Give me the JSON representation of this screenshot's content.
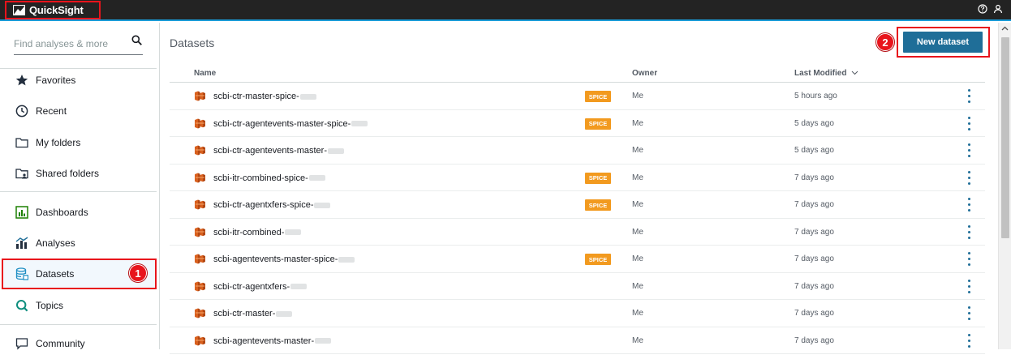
{
  "app": {
    "name": "QuickSight",
    "accent_color": "#1b9bd7",
    "highlight_color": "#e8141c",
    "primary_button_color": "#1f6e98"
  },
  "topbar": {
    "icons": [
      "help-icon",
      "user-icon"
    ]
  },
  "sidebar": {
    "search_placeholder": "Find analyses & more",
    "items": [
      {
        "label": "Favorites",
        "icon": "star-icon"
      },
      {
        "label": "Recent",
        "icon": "clock-icon"
      },
      {
        "label": "My folders",
        "icon": "folder-icon"
      },
      {
        "label": "Shared folders",
        "icon": "shared-folder-icon"
      },
      {
        "label": "Dashboards",
        "icon": "dashboard-icon"
      },
      {
        "label": "Analyses",
        "icon": "analyses-icon"
      },
      {
        "label": "Datasets",
        "icon": "dataset-icon",
        "active": true
      },
      {
        "label": "Topics",
        "icon": "topics-icon"
      },
      {
        "label": "Community",
        "icon": "community-icon"
      }
    ],
    "step_badge": "1"
  },
  "main": {
    "title": "Datasets",
    "new_button_label": "New dataset",
    "step_badge": "2",
    "columns": {
      "name": "Name",
      "owner": "Owner",
      "last_modified": "Last Modified"
    },
    "rows": [
      {
        "name": "scbi-ctr-master-spice-",
        "spice": "SPICE",
        "owner": "Me",
        "modified": "5 hours ago"
      },
      {
        "name": "scbi-ctr-agentevents-master-spice-",
        "spice": "SPICE",
        "owner": "Me",
        "modified": "5 days ago"
      },
      {
        "name": "scbi-ctr-agentevents-master-",
        "spice": "",
        "owner": "Me",
        "modified": "5 days ago"
      },
      {
        "name": "scbi-itr-combined-spice-",
        "spice": "SPICE",
        "owner": "Me",
        "modified": "7 days ago"
      },
      {
        "name": "scbi-ctr-agentxfers-spice-",
        "spice": "SPICE",
        "owner": "Me",
        "modified": "7 days ago"
      },
      {
        "name": "scbi-itr-combined-",
        "spice": "",
        "owner": "Me",
        "modified": "7 days ago"
      },
      {
        "name": "scbi-agentevents-master-spice-",
        "spice": "SPICE",
        "owner": "Me",
        "modified": "7 days ago"
      },
      {
        "name": "scbi-ctr-agentxfers-",
        "spice": "",
        "owner": "Me",
        "modified": "7 days ago"
      },
      {
        "name": "scbi-ctr-master-",
        "spice": "",
        "owner": "Me",
        "modified": "7 days ago"
      },
      {
        "name": "scbi-agentevents-master-",
        "spice": "",
        "owner": "Me",
        "modified": "7 days ago"
      }
    ]
  }
}
